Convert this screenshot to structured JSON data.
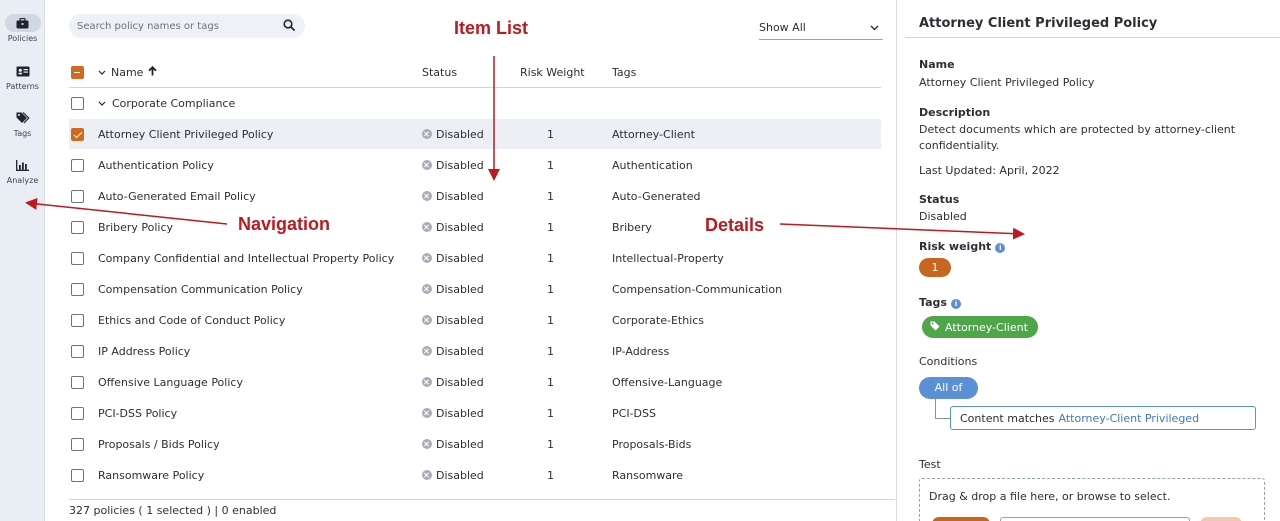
{
  "nav": {
    "items": [
      {
        "label": "Policies",
        "icon": "briefcase-icon",
        "active": true
      },
      {
        "label": "Patterns",
        "icon": "id-card-icon",
        "active": false
      },
      {
        "label": "Tags",
        "icon": "tags-icon",
        "active": false
      },
      {
        "label": "Analyze",
        "icon": "bar-chart-icon",
        "active": false
      }
    ]
  },
  "search": {
    "placeholder": "Search policy names or tags"
  },
  "filter": {
    "selected": "Show All"
  },
  "annotations": {
    "item_list": "Item List",
    "navigation": "Navigation",
    "details": "Details"
  },
  "table": {
    "columns": {
      "name": "Name",
      "status": "Status",
      "risk": "Risk Weight",
      "tags": "Tags"
    },
    "group": "Corporate Compliance",
    "rows": [
      {
        "name": "Attorney Client Privileged Policy",
        "status": "Disabled",
        "risk": "1",
        "tag": "Attorney-Client",
        "selected": true
      },
      {
        "name": "Authentication Policy",
        "status": "Disabled",
        "risk": "1",
        "tag": "Authentication",
        "selected": false
      },
      {
        "name": "Auto-Generated Email Policy",
        "status": "Disabled",
        "risk": "1",
        "tag": "Auto-Generated",
        "selected": false
      },
      {
        "name": "Bribery Policy",
        "status": "Disabled",
        "risk": "1",
        "tag": "Bribery",
        "selected": false
      },
      {
        "name": "Company Confidential and Intellectual Property Policy",
        "status": "Disabled",
        "risk": "1",
        "tag": "Intellectual-Property",
        "selected": false
      },
      {
        "name": "Compensation Communication Policy",
        "status": "Disabled",
        "risk": "1",
        "tag": "Compensation-Communication",
        "selected": false
      },
      {
        "name": "Ethics and Code of Conduct Policy",
        "status": "Disabled",
        "risk": "1",
        "tag": "Corporate-Ethics",
        "selected": false
      },
      {
        "name": "IP Address Policy",
        "status": "Disabled",
        "risk": "1",
        "tag": "IP-Address",
        "selected": false
      },
      {
        "name": "Offensive Language Policy",
        "status": "Disabled",
        "risk": "1",
        "tag": "Offensive-Language",
        "selected": false
      },
      {
        "name": "PCI-DSS Policy",
        "status": "Disabled",
        "risk": "1",
        "tag": "PCI-DSS",
        "selected": false
      },
      {
        "name": "Proposals / Bids Policy",
        "status": "Disabled",
        "risk": "1",
        "tag": "Proposals-Bids",
        "selected": false
      },
      {
        "name": "Ransomware Policy",
        "status": "Disabled",
        "risk": "1",
        "tag": "Ransomware",
        "selected": false
      }
    ]
  },
  "footer": "327 policies ( 1 selected ) | 0 enabled",
  "details": {
    "title": "Attorney Client Privileged Policy",
    "name_label": "Name",
    "name_value": "Attorney Client Privileged Policy",
    "description_label": "Description",
    "description_line1": "Detect documents which are protected by attorney-client",
    "description_line2": "confidentiality.",
    "last_updated": "Last Updated: April, 2022",
    "status_label": "Status",
    "status_value": "Disabled",
    "risk_label": "Risk weight",
    "risk_value": "1",
    "tags_label": "Tags",
    "tag_value": "Attorney-Client",
    "conditions_label": "Conditions",
    "all_of": "All of",
    "condition_text": "Content matches",
    "condition_link": "Attorney-Client Privileged",
    "test_label": "Test",
    "drop_text": "Drag & drop a file here, or browse to select."
  },
  "colors": {
    "accent_orange": "#d2691e",
    "tag_green": "#4fa64a",
    "link_blue": "#3f77c8",
    "annotation_red": "#c0181c"
  }
}
